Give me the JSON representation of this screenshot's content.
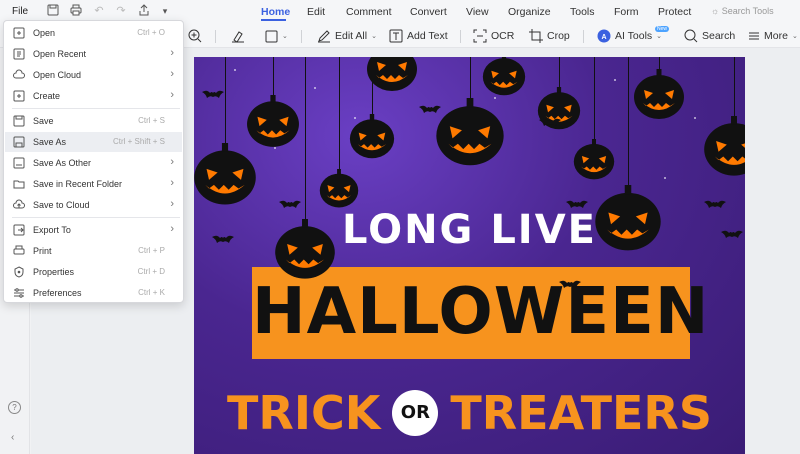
{
  "title_bar": {
    "file_label": "File",
    "tabs": [
      {
        "label": "Home",
        "active": true
      },
      {
        "label": "Edit"
      },
      {
        "label": "Comment"
      },
      {
        "label": "Convert"
      },
      {
        "label": "View"
      },
      {
        "label": "Organize"
      },
      {
        "label": "Tools"
      },
      {
        "label": "Form"
      },
      {
        "label": "Protect"
      }
    ],
    "search_placeholder": "Search Tools"
  },
  "toolbar": {
    "edit_all": "Edit All",
    "add_text": "Add Text",
    "ocr": "OCR",
    "crop": "Crop",
    "ai_tools": "AI Tools",
    "ai_badge": "New",
    "search": "Search",
    "more": "More"
  },
  "file_menu": {
    "items": [
      {
        "label": "Open",
        "shortcut": "Ctrl + O"
      },
      {
        "label": "Open Recent",
        "submenu": true
      },
      {
        "label": "Open Cloud",
        "submenu": true
      },
      {
        "label": "Create",
        "submenu": true
      },
      {
        "label": "Save",
        "shortcut": "Ctrl + S"
      },
      {
        "label": "Save As",
        "shortcut": "Ctrl + Shift + S",
        "hover": true
      },
      {
        "label": "Save As Other",
        "submenu": true
      },
      {
        "label": "Save in Recent Folder",
        "submenu": true
      },
      {
        "label": "Save to Cloud",
        "submenu": true
      },
      {
        "label": "Export To",
        "submenu": true
      },
      {
        "label": "Print",
        "shortcut": "Ctrl + P"
      },
      {
        "label": "Properties",
        "shortcut": "Ctrl + D"
      },
      {
        "label": "Preferences",
        "shortcut": "Ctrl + K"
      }
    ]
  },
  "document": {
    "line1": "LONG LIVE",
    "line2": "HALLOWEEN",
    "line3_left": "TRICK",
    "line3_badge": "OR",
    "line3_right": "TREATERS"
  },
  "sidebar": {
    "help_glyph": "?",
    "collapse_glyph": "‹"
  },
  "colors": {
    "accent": "#3b61e0",
    "poster_purple": "#4a2690",
    "halloween_orange": "#f7931e"
  }
}
